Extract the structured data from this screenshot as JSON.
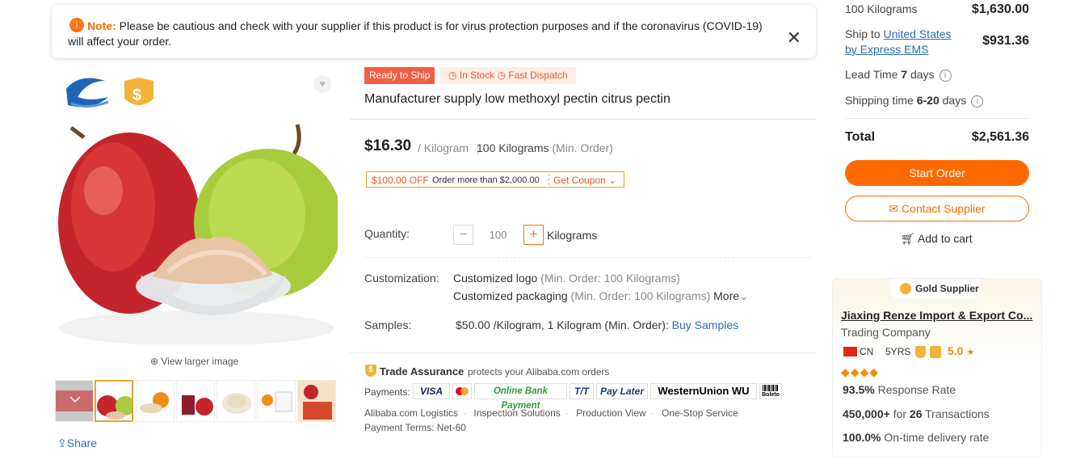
{
  "notice": {
    "label": "Note:",
    "text": "Please be cautious and check with your supplier if this product is for virus protection purposes and if the coronavirus (COVID-19) will affect your order.",
    "close": "✕"
  },
  "gallery": {
    "view_larger": "View larger image",
    "share": "Share",
    "thumbnail_count": 7,
    "selected_thumbnail": 1
  },
  "product": {
    "badge_ready": "Ready to Ship",
    "badge_stock": "In Stock",
    "badge_dispatch": "Fast Dispatch",
    "title": "Manufacturer supply low methoxyl pectin citrus pectin",
    "price": "$16.30",
    "price_unit": "/ Kilogram",
    "min_order": "100 Kilograms",
    "min_order_suffix": "(Min. Order)",
    "coupon": {
      "off": "$100.00 OFF",
      "condition": "Order more than $2,000.00",
      "action": "Get Coupon"
    },
    "quantity": {
      "label": "Quantity:",
      "value": "100",
      "unit": "Kilograms",
      "minus": "−",
      "plus": "+"
    },
    "customization": {
      "label": "Customization:",
      "logo": "Customized logo",
      "logo_min": "(Min. Order: 100 Kilograms)",
      "packaging": "Customized packaging",
      "packaging_min": "(Min. Order: 100 Kilograms)",
      "more": "More"
    },
    "samples": {
      "label": "Samples:",
      "value": "$50.00 /Kilogram, 1 Kilogram (Min. Order):",
      "link": "Buy Samples"
    },
    "trade_assurance": {
      "title": "Trade Assurance",
      "desc": "protects your Alibaba.com orders",
      "payments_label": "Payments:",
      "payments": [
        "VISA",
        "",
        "Online Bank Payment",
        "T/T",
        "Pay Later",
        "WesternUnion WU",
        "Boleto"
      ],
      "links": [
        "Alibaba.com Logistics",
        "Inspection Solutions",
        "Production View",
        "One-Stop Service"
      ],
      "terms": "Payment Terms: Net-60"
    }
  },
  "order_summary": {
    "row1_label": "100 Kilograms",
    "row1_value": "$1,630.00",
    "ship_to": "Ship to",
    "ship_country": "United States",
    "ship_method": "by Express EMS",
    "ship_value": "$931.36",
    "lead_time_label": "Lead Time",
    "lead_time_value": "7",
    "lead_time_unit": "days",
    "shipping_time_label": "Shipping time",
    "shipping_time_value": "6-20",
    "shipping_time_unit": "days",
    "total_label": "Total",
    "total_value": "$2,561.36",
    "start_order": "Start Order",
    "contact": "Contact Supplier",
    "add_to_cart": "Add to cart"
  },
  "supplier": {
    "badge": "Gold Supplier",
    "name": "Jiaxing Renze Import & Export Co...",
    "type": "Trading Company",
    "country": "CN",
    "years": "5YRS",
    "rating": "5.0",
    "diamonds": "◆◆◆◆",
    "response_rate": "93.5%",
    "response_label": "Response Rate",
    "transactions_amount": "450,000+",
    "transactions_for": "for",
    "transactions_count": "26",
    "transactions_label": "Transactions",
    "ontime_rate": "100.0%",
    "ontime_label": "On-time delivery rate"
  },
  "colors": {
    "accent": "#ff6a00",
    "link": "#2b6fb6",
    "badge_red": "#f25e42",
    "gold": "#f3b339"
  }
}
